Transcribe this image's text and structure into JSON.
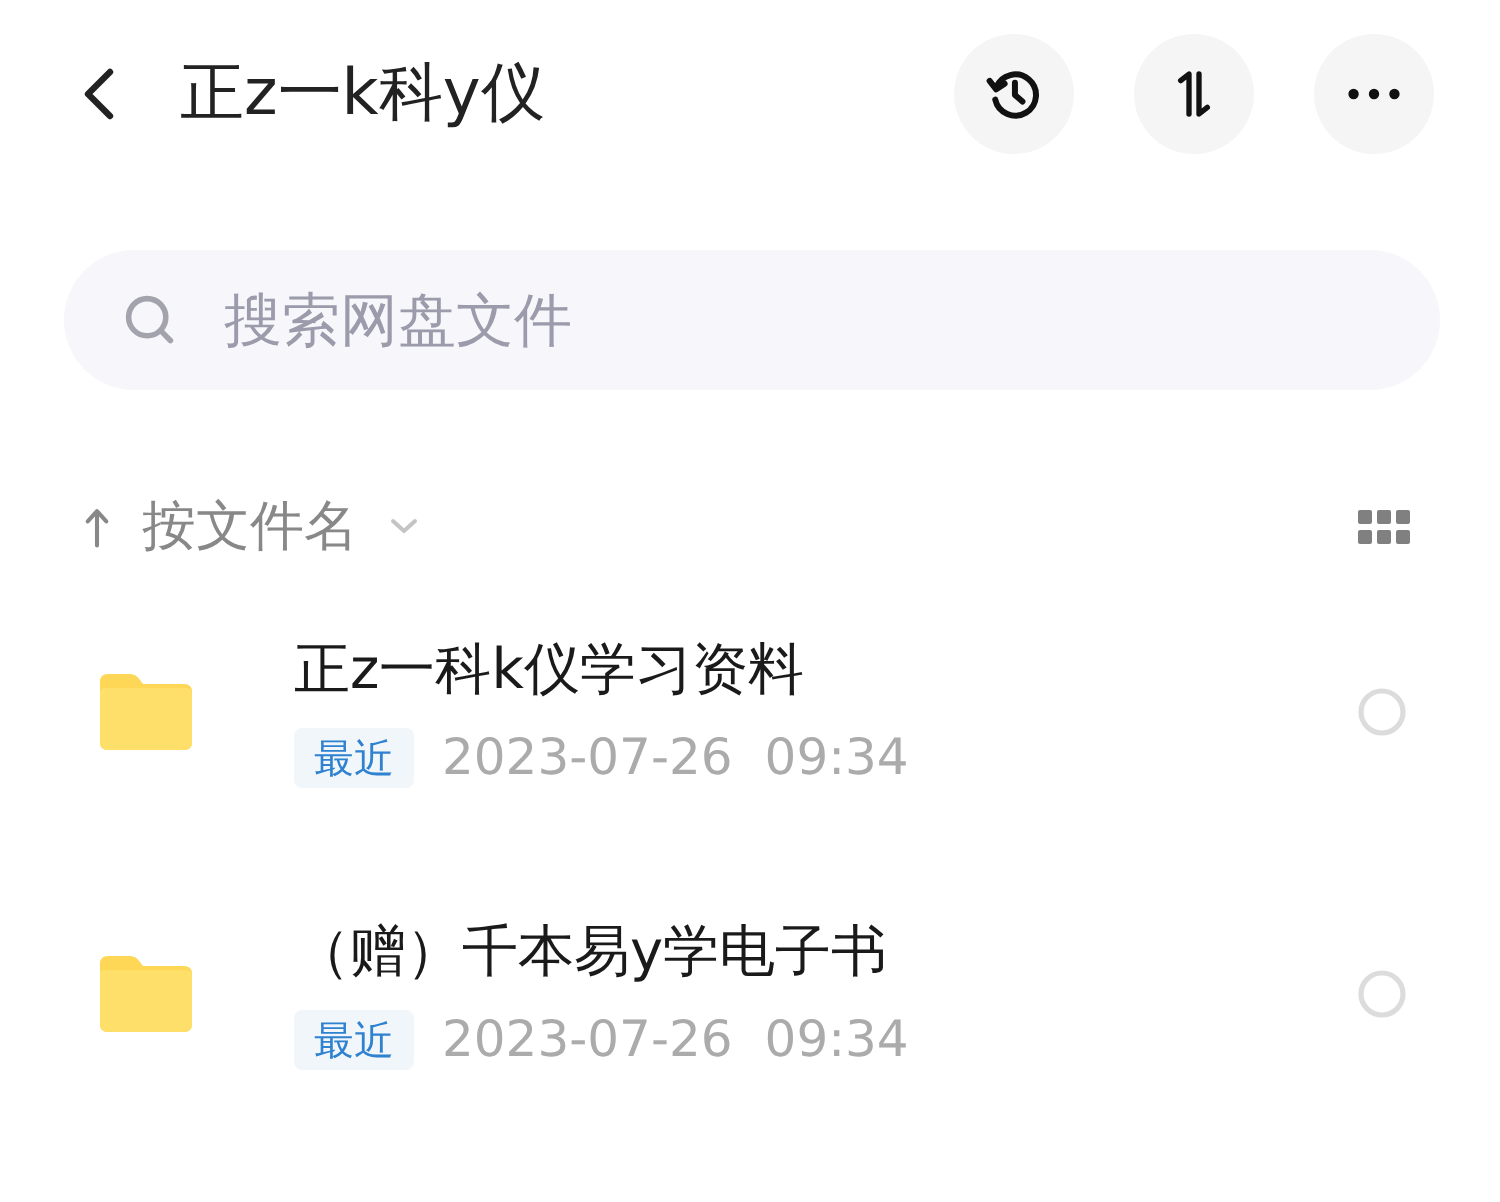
{
  "header": {
    "title": "正z一k科y仪"
  },
  "search": {
    "placeholder": "搜索网盘文件"
  },
  "sort": {
    "label": "按文件名",
    "ascending": true
  },
  "files": [
    {
      "name": "正z一科k仪学习资料",
      "tag": "最近",
      "date": "2023-07-26",
      "time": "09:34",
      "selected": false
    },
    {
      "name": "（赠）千本易y学电子书",
      "tag": "最近",
      "date": "2023-07-26",
      "time": "09:34",
      "selected": false
    }
  ]
}
